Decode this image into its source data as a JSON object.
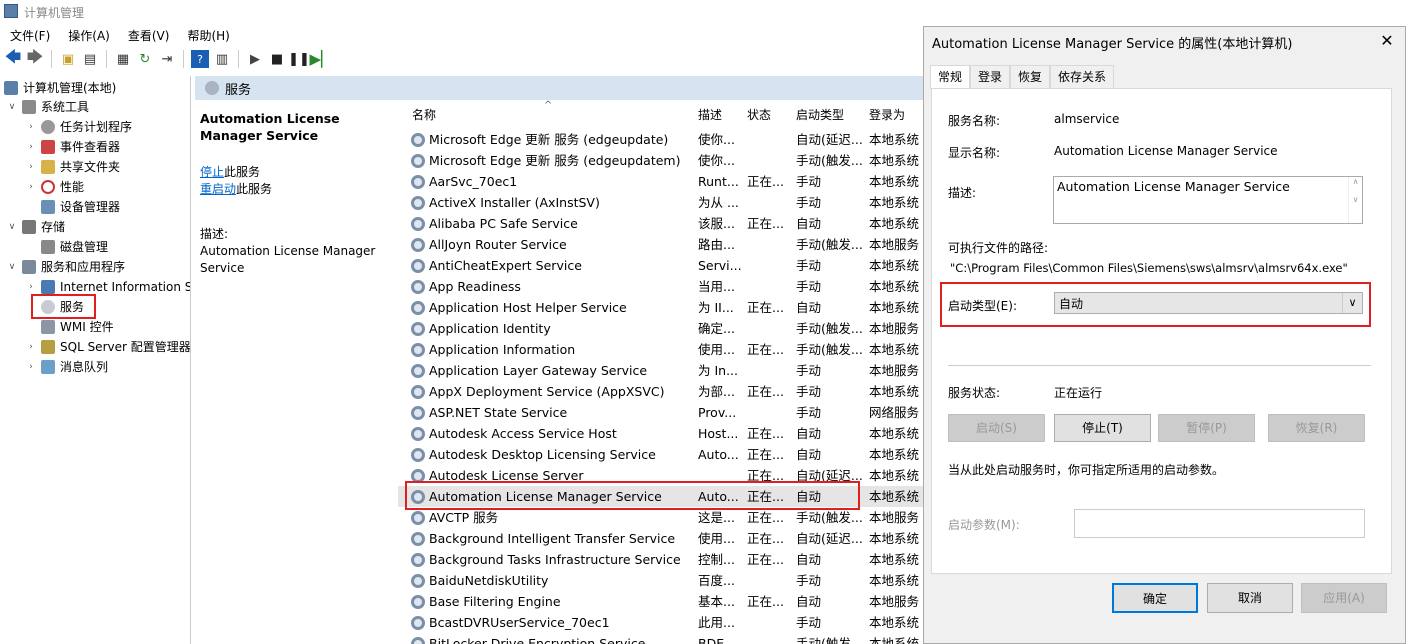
{
  "app": {
    "title": "计算机管理"
  },
  "menu": [
    "文件(F)",
    "操作(A)",
    "查看(V)",
    "帮助(H)"
  ],
  "tree": {
    "root": "计算机管理(本地)",
    "system_tools": "系统工具",
    "task_scheduler": "任务计划程序",
    "event_viewer": "事件查看器",
    "shared_folders": "共享文件夹",
    "performance": "性能",
    "device_manager": "设备管理器",
    "storage": "存储",
    "disk_management": "磁盘管理",
    "services_apps": "服务和应用程序",
    "iis": "Internet Information S",
    "services": "服务",
    "wmi": "WMI 控件",
    "sql": "SQL Server 配置管理器",
    "msmq": "消息队列"
  },
  "middle": {
    "header": "服务",
    "service_title": "Automation License Manager Service",
    "stop_link": "停止",
    "stop_suffix": "此服务",
    "restart_link": "重启动",
    "restart_suffix": "此服务",
    "desc_label": "描述:",
    "desc_text": "Automation License Manager Service"
  },
  "columns": [
    "名称",
    "描述",
    "状态",
    "启动类型",
    "登录为"
  ],
  "services": [
    {
      "name": "Microsoft Edge 更新 服务 (edgeupdate)",
      "desc": "使你...",
      "status": "",
      "startup": "自动(延迟...",
      "logon": "本地系统"
    },
    {
      "name": "Microsoft Edge 更新 服务 (edgeupdatem)",
      "desc": "使你...",
      "status": "",
      "startup": "手动(触发...",
      "logon": "本地系统"
    },
    {
      "name": "AarSvc_70ec1",
      "desc": "Runt...",
      "status": "正在...",
      "startup": "手动",
      "logon": "本地系统"
    },
    {
      "name": "ActiveX Installer (AxInstSV)",
      "desc": "为从 ...",
      "status": "",
      "startup": "手动",
      "logon": "本地系统"
    },
    {
      "name": "Alibaba PC Safe Service",
      "desc": "该服...",
      "status": "正在...",
      "startup": "自动",
      "logon": "本地系统"
    },
    {
      "name": "AllJoyn Router Service",
      "desc": "路由...",
      "status": "",
      "startup": "手动(触发...",
      "logon": "本地服务"
    },
    {
      "name": "AntiCheatExpert Service",
      "desc": "Servi...",
      "status": "",
      "startup": "手动",
      "logon": "本地系统"
    },
    {
      "name": "App Readiness",
      "desc": "当用...",
      "status": "",
      "startup": "手动",
      "logon": "本地系统"
    },
    {
      "name": "Application Host Helper Service",
      "desc": "为 II...",
      "status": "正在...",
      "startup": "自动",
      "logon": "本地系统"
    },
    {
      "name": "Application Identity",
      "desc": "确定...",
      "status": "",
      "startup": "手动(触发...",
      "logon": "本地服务"
    },
    {
      "name": "Application Information",
      "desc": "使用...",
      "status": "正在...",
      "startup": "手动(触发...",
      "logon": "本地系统"
    },
    {
      "name": "Application Layer Gateway Service",
      "desc": "为 In...",
      "status": "",
      "startup": "手动",
      "logon": "本地服务"
    },
    {
      "name": "AppX Deployment Service (AppXSVC)",
      "desc": "为部...",
      "status": "正在...",
      "startup": "手动",
      "logon": "本地系统"
    },
    {
      "name": "ASP.NET State Service",
      "desc": "Prov...",
      "status": "",
      "startup": "手动",
      "logon": "网络服务"
    },
    {
      "name": "Autodesk Access Service Host",
      "desc": "Host...",
      "status": "正在...",
      "startup": "自动",
      "logon": "本地系统"
    },
    {
      "name": "Autodesk Desktop Licensing Service",
      "desc": "Auto...",
      "status": "正在...",
      "startup": "自动",
      "logon": "本地系统"
    },
    {
      "name": "Autodesk License Server",
      "desc": "",
      "status": "正在...",
      "startup": "自动(延迟...",
      "logon": "本地系统"
    },
    {
      "name": "Automation License Manager Service",
      "desc": "Auto...",
      "status": "正在...",
      "startup": "自动",
      "logon": "本地系统"
    },
    {
      "name": "AVCTP 服务",
      "desc": "这是...",
      "status": "正在...",
      "startup": "手动(触发...",
      "logon": "本地服务"
    },
    {
      "name": "Background Intelligent Transfer Service",
      "desc": "使用...",
      "status": "正在...",
      "startup": "自动(延迟...",
      "logon": "本地系统"
    },
    {
      "name": "Background Tasks Infrastructure Service",
      "desc": "控制...",
      "status": "正在...",
      "startup": "自动",
      "logon": "本地系统"
    },
    {
      "name": "BaiduNetdiskUtility",
      "desc": "百度...",
      "status": "",
      "startup": "手动",
      "logon": "本地系统"
    },
    {
      "name": "Base Filtering Engine",
      "desc": "基本...",
      "status": "正在...",
      "startup": "自动",
      "logon": "本地服务"
    },
    {
      "name": "BcastDVRUserService_70ec1",
      "desc": "此用...",
      "status": "",
      "startup": "手动",
      "logon": "本地系统"
    },
    {
      "name": "BitLocker Drive Encryption Service",
      "desc": "BDE...",
      "status": "",
      "startup": "手动(触发...",
      "logon": "本地系统"
    }
  ],
  "dialog": {
    "title": "Automation License Manager Service 的属性(本地计算机)",
    "tabs": [
      "常规",
      "登录",
      "恢复",
      "依存关系"
    ],
    "service_name_label": "服务名称:",
    "service_name": "almservice",
    "display_name_label": "显示名称:",
    "display_name": "Automation License Manager Service",
    "description_label": "描述:",
    "description": "Automation License Manager Service",
    "path_label": "可执行文件的路径:",
    "path": "\"C:\\Program Files\\Common Files\\Siemens\\sws\\almsrv\\almsrv64x.exe\"",
    "startup_type_label": "启动类型(E):",
    "startup_type": "自动",
    "status_label": "服务状态:",
    "status": "正在运行",
    "btn_start": "启动(S)",
    "btn_stop": "停止(T)",
    "btn_pause": "暂停(P)",
    "btn_resume": "恢复(R)",
    "hint": "当从此处启动服务时，你可指定所适用的启动参数。",
    "params_label": "启动参数(M):",
    "ok": "确定",
    "cancel": "取消",
    "apply": "应用(A)"
  }
}
